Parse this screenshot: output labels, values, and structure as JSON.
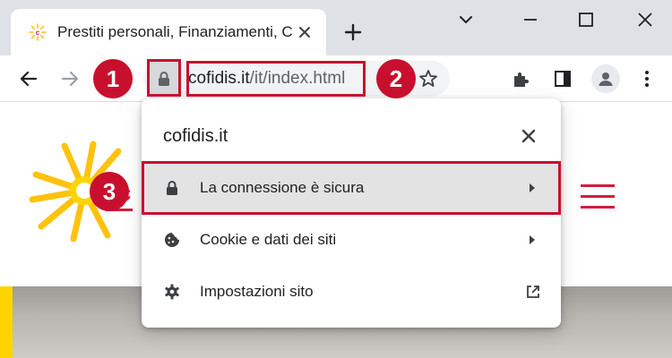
{
  "browser": {
    "tab": {
      "title": "Prestiti personali, Finanziamenti, C"
    },
    "address_bar": {
      "host": "cofidis.it",
      "path": "/it/index.html"
    }
  },
  "popup": {
    "title": "cofidis.it",
    "items": [
      {
        "icon": "lock-icon",
        "label": "La connessione è sicura",
        "trailing": "chevron-right-icon",
        "highlighted": true
      },
      {
        "icon": "cookie-icon",
        "label": "Cookie e dati dei siti",
        "trailing": "chevron-right-icon",
        "highlighted": false
      },
      {
        "icon": "gear-icon",
        "label": "Impostazioni sito",
        "trailing": "open-external-icon",
        "highlighted": false
      }
    ]
  },
  "annotations": {
    "step1": "1",
    "step2": "2",
    "step3": "3",
    "color": "#c8102e"
  },
  "colors": {
    "brand_red": "#d21e3c",
    "brand_yellow": "#ffd400",
    "tabstrip": "#dee1e6",
    "selected_row": "#e3e3e3"
  }
}
